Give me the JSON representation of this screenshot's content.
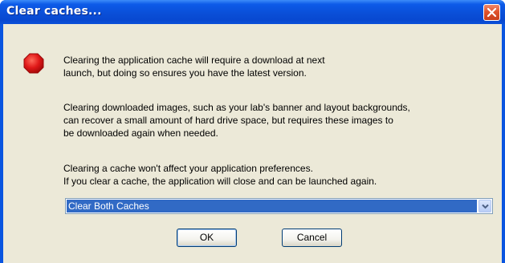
{
  "dialog": {
    "title": "Clear caches...",
    "close_icon": "close-icon",
    "stop_icon": "stop-octagon-icon",
    "colors": {
      "titlebar": "#0a4fd8",
      "background": "#ece9d8",
      "selection": "#316ac5",
      "stop_icon": "#e01818"
    },
    "messages": {
      "p1": [
        "Clearing the application cache will require a download at next",
        "launch, but doing so ensures you have the latest version."
      ],
      "p2": [
        "Clearing downloaded images, such as your lab's banner and layout backgrounds,",
        "can recover a small amount of hard drive space, but requires these images to",
        "be downloaded again when needed."
      ],
      "p3": [
        "Clearing a cache won't affect your application preferences.",
        "If you clear a cache, the application will close and can be launched again."
      ]
    },
    "select": {
      "value": "Clear Both Caches",
      "arrow_icon": "chevron-down-icon"
    },
    "buttons": {
      "ok_label": "OK",
      "cancel_label": "Cancel"
    }
  }
}
